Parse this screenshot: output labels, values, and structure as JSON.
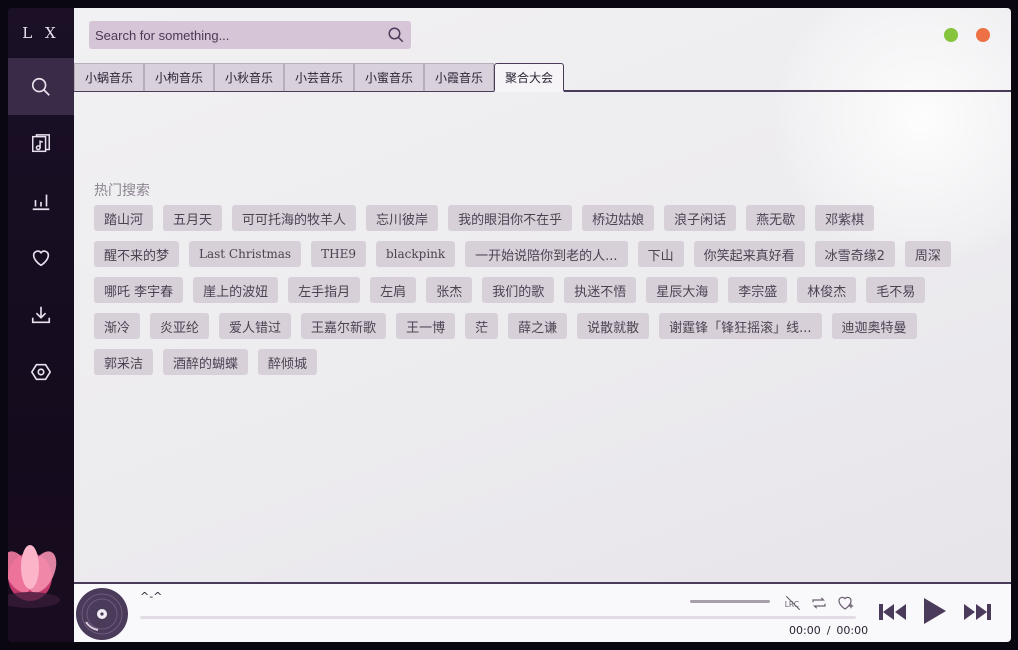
{
  "app": {
    "logo": "L X"
  },
  "sidebar": {
    "items": [
      {
        "name": "search",
        "icon": "search-icon"
      },
      {
        "name": "song-list",
        "icon": "music-list-icon"
      },
      {
        "name": "leaderboard",
        "icon": "chart-icon"
      },
      {
        "name": "favorites",
        "icon": "heart-icon"
      },
      {
        "name": "download",
        "icon": "download-icon"
      },
      {
        "name": "settings",
        "icon": "settings-icon"
      }
    ]
  },
  "search": {
    "placeholder": "Search for something...",
    "value": ""
  },
  "window_controls": {
    "minimize_color": "#85c43b",
    "close_color": "#ee7045"
  },
  "tabs": [
    {
      "label": "小蜗音乐"
    },
    {
      "label": "小枸音乐"
    },
    {
      "label": "小秋音乐"
    },
    {
      "label": "小芸音乐"
    },
    {
      "label": "小蜜音乐"
    },
    {
      "label": "小霞音乐"
    },
    {
      "label": "聚合大会"
    }
  ],
  "active_tab": "聚合大会",
  "hot_search": {
    "title": "热门搜索",
    "tags": [
      "踏山河",
      "五月天",
      "可可托海的牧羊人",
      "忘川彼岸",
      "我的眼泪你不在乎",
      "桥边姑娘",
      "浪子闲话",
      "燕无歇",
      "邓紫棋",
      "醒不来的梦",
      "Last Christmas",
      "THE9",
      "blackpink",
      "一开始说陪你到老的人...",
      "下山",
      "你笑起来真好看",
      "冰雪奇缘2",
      "周深",
      "哪吒 李宇春",
      "崖上的波妞",
      "左手指月",
      "左肩",
      "张杰",
      "我们的歌",
      "执迷不悟",
      "星辰大海",
      "李宗盛",
      "林俊杰",
      "毛不易",
      "渐冷",
      "炎亚纶",
      "爱人错过",
      "王嘉尔新歌",
      "王一博",
      "茫",
      "薛之谦",
      "说散就散",
      "谢霆锋「锋狂摇滚」线...",
      "迪迦奥特曼",
      "郭采洁",
      "酒醉的蝴蝶",
      "醉倾城"
    ]
  },
  "player": {
    "title": "^-^",
    "current_time": "00:00",
    "separator": "/",
    "total_time": "00:00",
    "progress": 0,
    "icons": [
      "lyrics-off-icon",
      "repeat-icon",
      "favorite-add-icon",
      "previous-icon",
      "play-icon",
      "next-icon"
    ],
    "accent": "#4b3b5a"
  }
}
